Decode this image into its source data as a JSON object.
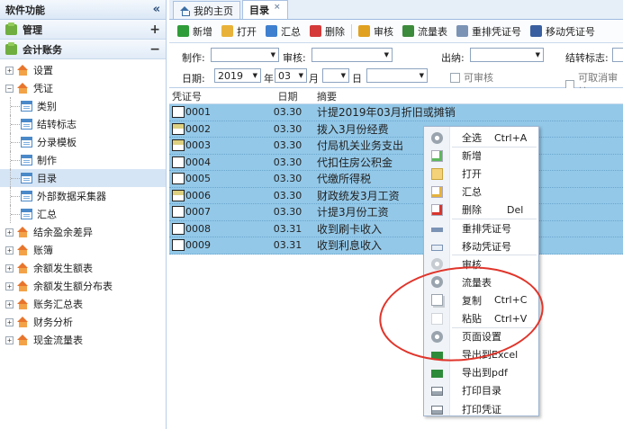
{
  "sidebar": {
    "title": "软件功能",
    "collapse_glyph": "«",
    "sections": [
      {
        "label": "管理",
        "toggle": "+"
      },
      {
        "label": "会计账务",
        "toggle": "−"
      }
    ],
    "tree": [
      {
        "label": "设置",
        "pm": "+"
      },
      {
        "label": "凭证",
        "pm": "−"
      },
      {
        "label": "类别"
      },
      {
        "label": "结转标志"
      },
      {
        "label": "分录模板"
      },
      {
        "label": "制作"
      },
      {
        "label": "目录"
      },
      {
        "label": "外部数据采集器"
      },
      {
        "label": "汇总"
      },
      {
        "label": "结余盈余差异",
        "pm": "+"
      },
      {
        "label": "账簿",
        "pm": "+"
      },
      {
        "label": "余额发生额表",
        "pm": "+"
      },
      {
        "label": "余额发生额分布表",
        "pm": "+"
      },
      {
        "label": "账务汇总表",
        "pm": "+"
      },
      {
        "label": "财务分析",
        "pm": "+"
      },
      {
        "label": "现金流量表",
        "pm": "+"
      }
    ]
  },
  "tabs": [
    {
      "label": "我的主页"
    },
    {
      "label": "目录",
      "close": "×"
    }
  ],
  "toolbar": [
    "新增",
    "打开",
    "汇总",
    "删除",
    "审核",
    "流量表",
    "重排凭证号",
    "移动凭证号"
  ],
  "toolbar_icons": [
    {
      "name": "add-icon",
      "color": "#2f9c3a"
    },
    {
      "name": "open-icon",
      "color": "#e8b23a"
    },
    {
      "name": "summary-icon",
      "color": "#3f7fd0"
    },
    {
      "name": "delete-icon",
      "color": "#d43a3a"
    },
    {
      "name": "audit-icon",
      "color": "#e0a020"
    },
    {
      "name": "flow-icon",
      "color": "#3c8a3c"
    },
    {
      "name": "renumber-icon",
      "color": "#7b93b5"
    },
    {
      "name": "move-icon",
      "color": "#3a5fa0"
    }
  ],
  "filter": {
    "maker_label": "制作:",
    "auditor_label": "审核:",
    "cashier_label": "出纳:",
    "carry_label": "结转标志:",
    "date_label": "日期:",
    "year": "2019",
    "year_unit": "年",
    "month": "03",
    "month_unit": "月",
    "day_unit": "日",
    "can_audit": "可审核",
    "can_cancel_audit": "可取消审核"
  },
  "grid": {
    "headers": [
      "凭证号",
      "日期",
      "摘要"
    ],
    "rows": [
      {
        "num": "0001",
        "date": "03.30",
        "summary": "计提2019年03月折旧或摊销",
        "flag": false
      },
      {
        "num": "0002",
        "date": "03.30",
        "summary": "拨入3月份经费",
        "flag": true
      },
      {
        "num": "0003",
        "date": "03.30",
        "summary": "付局机关业务支出",
        "flag": true
      },
      {
        "num": "0004",
        "date": "03.30",
        "summary": "代扣住房公积金",
        "flag": false
      },
      {
        "num": "0005",
        "date": "03.30",
        "summary": "代缴所得税",
        "flag": false
      },
      {
        "num": "0006",
        "date": "03.30",
        "summary": "财政统发3月工资",
        "flag": true
      },
      {
        "num": "0007",
        "date": "03.30",
        "summary": "计提3月份工资",
        "flag": false
      },
      {
        "num": "0008",
        "date": "03.31",
        "summary": "收到刷卡收入",
        "flag": false
      },
      {
        "num": "0009",
        "date": "03.31",
        "summary": "收到利息收入",
        "flag": false
      }
    ]
  },
  "context_menu": [
    {
      "label": "全选",
      "shortcut": "Ctrl+A",
      "icon": "select-all-icon"
    },
    {
      "label": "新增",
      "icon": "add-icon"
    },
    {
      "label": "打开",
      "icon": "open-icon"
    },
    {
      "label": "汇总",
      "icon": "summary-icon"
    },
    {
      "label": "删除",
      "shortcut": "Del",
      "icon": "delete-icon"
    },
    {
      "label": "重排凭证号",
      "icon": "renumber-icon"
    },
    {
      "label": "移动凭证号",
      "icon": "move-icon"
    },
    {
      "label": "审核",
      "icon": "audit-icon"
    },
    {
      "label": "流量表",
      "icon": "flow-icon"
    },
    {
      "label": "复制",
      "shortcut": "Ctrl+C",
      "icon": "copy-icon"
    },
    {
      "label": "粘贴",
      "shortcut": "Ctrl+V",
      "icon": "paste-icon"
    },
    {
      "label": "页面设置",
      "icon": "page-setup-icon"
    },
    {
      "label": "导出到Excel",
      "icon": "excel-icon"
    },
    {
      "label": "导出到pdf",
      "icon": "pdf-icon"
    },
    {
      "label": "打印目录",
      "icon": "print-icon"
    },
    {
      "label": "打印凭证",
      "icon": "print-icon"
    }
  ],
  "colors": {
    "row_selected": "#93c8e8",
    "highlight_ring": "#e0352b"
  }
}
